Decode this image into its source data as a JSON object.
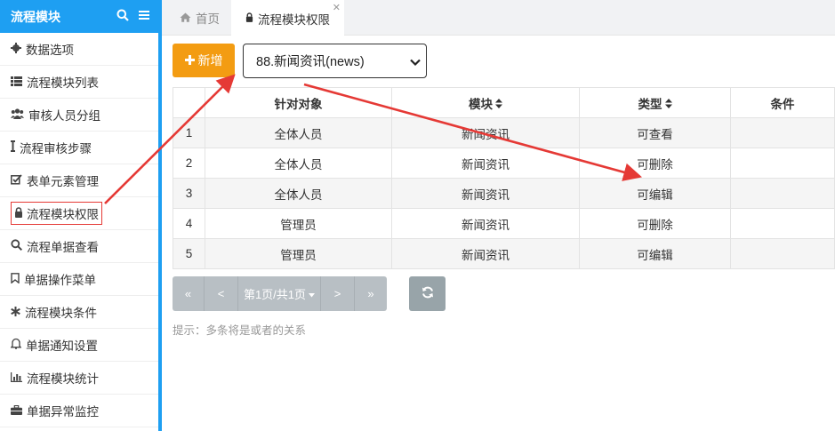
{
  "sidebar": {
    "title": "流程模块",
    "items": [
      {
        "label": "数据选项",
        "icon": "gear-icon"
      },
      {
        "label": "流程模块列表",
        "icon": "list-icon"
      },
      {
        "label": "审核人员分组",
        "icon": "users-icon"
      },
      {
        "label": "流程审核步骤",
        "icon": "steps-icon"
      },
      {
        "label": "表单元素管理",
        "icon": "checkbox-icon"
      },
      {
        "label": "流程模块权限",
        "icon": "lock-icon"
      },
      {
        "label": "流程单据查看",
        "icon": "search-icon"
      },
      {
        "label": "单据操作菜单",
        "icon": "bookmark-icon"
      },
      {
        "label": "流程模块条件",
        "icon": "asterisk-icon"
      },
      {
        "label": "单据通知设置",
        "icon": "bell-icon"
      },
      {
        "label": "流程模块统计",
        "icon": "bar-chart-icon"
      },
      {
        "label": "单据异常监控",
        "icon": "briefcase-icon"
      }
    ]
  },
  "tabs": [
    {
      "label": "首页",
      "icon": "home-icon"
    },
    {
      "label": "流程模块权限",
      "icon": "lock-icon"
    }
  ],
  "toolbar": {
    "add_label": "新增",
    "select_value": "88.新闻资讯(news)"
  },
  "table": {
    "headers": [
      "针对对象",
      "模块",
      "类型",
      "条件"
    ],
    "rows": [
      {
        "idx": "1",
        "target": "全体人员",
        "module": "新闻资讯",
        "type": "可查看",
        "cond": ""
      },
      {
        "idx": "2",
        "target": "全体人员",
        "module": "新闻资讯",
        "type": "可删除",
        "cond": ""
      },
      {
        "idx": "3",
        "target": "全体人员",
        "module": "新闻资讯",
        "type": "可编辑",
        "cond": ""
      },
      {
        "idx": "4",
        "target": "管理员",
        "module": "新闻资讯",
        "type": "可删除",
        "cond": ""
      },
      {
        "idx": "5",
        "target": "管理员",
        "module": "新闻资讯",
        "type": "可编辑",
        "cond": ""
      }
    ]
  },
  "pager": {
    "first": "«",
    "prev": "<",
    "page_label": "第1页/共1页",
    "next": ">",
    "last": "»"
  },
  "hint": "提示：多条将是或者的关系",
  "colors": {
    "brand": "#1e9ff2",
    "add_button": "#f39c12",
    "annotation": "#e53935"
  }
}
